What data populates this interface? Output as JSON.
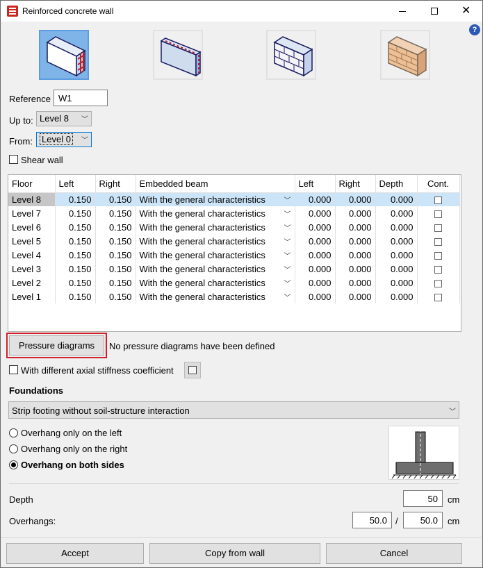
{
  "window": {
    "title": "Reinforced concrete wall",
    "minimize": "─",
    "maximize": "□",
    "close": "✕",
    "help": "?"
  },
  "wall_types": [
    {
      "icon": "rc-wall-icon",
      "selected": true
    },
    {
      "icon": "rc-wall-edge-icon",
      "selected": false
    },
    {
      "icon": "block-masonry-wall-icon",
      "selected": false
    },
    {
      "icon": "brick-masonry-wall-icon",
      "selected": false
    }
  ],
  "form": {
    "reference_label": "Reference",
    "reference_value": "W1",
    "upto_label": "Up to:",
    "upto_value": "Level 8",
    "from_label": "From:",
    "from_value": "Level 0",
    "shear_wall_label": "Shear wall"
  },
  "table": {
    "headers": [
      "Floor",
      "Left",
      "Right",
      "Embedded beam",
      "Left",
      "Right",
      "Depth",
      "Cont."
    ],
    "rows": [
      {
        "floor": "Level 8",
        "left": "0.150",
        "right": "0.150",
        "beam": "With the general characteristics",
        "b_left": "0.000",
        "b_right": "0.000",
        "depth": "0.000"
      },
      {
        "floor": "Level 7",
        "left": "0.150",
        "right": "0.150",
        "beam": "With the general characteristics",
        "b_left": "0.000",
        "b_right": "0.000",
        "depth": "0.000"
      },
      {
        "floor": "Level 6",
        "left": "0.150",
        "right": "0.150",
        "beam": "With the general characteristics",
        "b_left": "0.000",
        "b_right": "0.000",
        "depth": "0.000"
      },
      {
        "floor": "Level 5",
        "left": "0.150",
        "right": "0.150",
        "beam": "With the general characteristics",
        "b_left": "0.000",
        "b_right": "0.000",
        "depth": "0.000"
      },
      {
        "floor": "Level 4",
        "left": "0.150",
        "right": "0.150",
        "beam": "With the general characteristics",
        "b_left": "0.000",
        "b_right": "0.000",
        "depth": "0.000"
      },
      {
        "floor": "Level 3",
        "left": "0.150",
        "right": "0.150",
        "beam": "With the general characteristics",
        "b_left": "0.000",
        "b_right": "0.000",
        "depth": "0.000"
      },
      {
        "floor": "Level 2",
        "left": "0.150",
        "right": "0.150",
        "beam": "With the general characteristics",
        "b_left": "0.000",
        "b_right": "0.000",
        "depth": "0.000"
      },
      {
        "floor": "Level 1",
        "left": "0.150",
        "right": "0.150",
        "beam": "With the general characteristics",
        "b_left": "0.000",
        "b_right": "0.000",
        "depth": "0.000"
      }
    ]
  },
  "pressure": {
    "button": "Pressure diagrams",
    "status": "No pressure diagrams have been defined"
  },
  "axial_label": "With different axial stiffness coefficient",
  "foundations": {
    "heading": "Foundations",
    "type": "Strip footing without soil-structure interaction",
    "options": [
      "Overhang only on the left",
      "Overhang only on the right",
      "Overhang on both sides"
    ],
    "selected_option": "Overhang on both sides"
  },
  "dims": {
    "depth_label": "Depth",
    "depth_value": "50",
    "depth_unit": "cm",
    "overhangs_label": "Overhangs:",
    "overhang_left": "50.0",
    "separator": "/",
    "overhang_right": "50.0",
    "overhangs_unit": "cm"
  },
  "buttons": {
    "accept": "Accept",
    "copy": "Copy from wall",
    "cancel": "Cancel"
  }
}
